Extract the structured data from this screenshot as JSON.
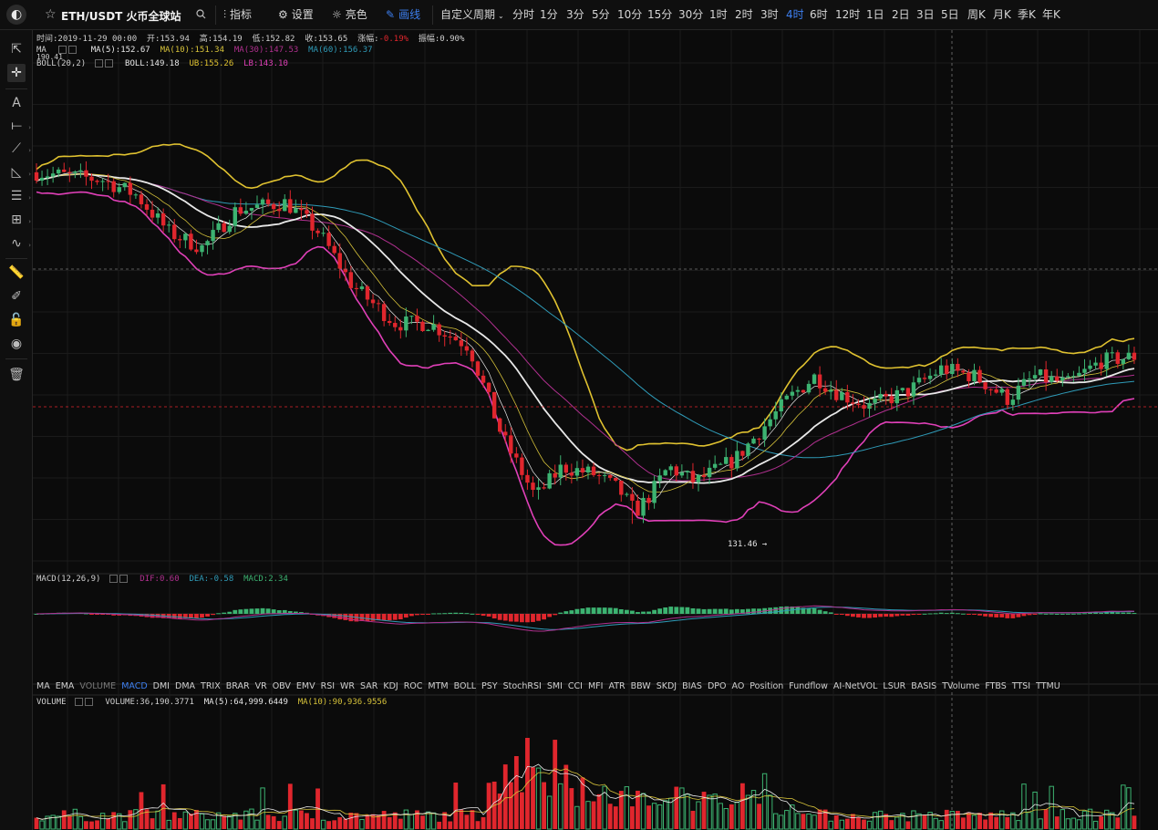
{
  "toolbar": {
    "symbol": "ETH/USDT 火币全球站",
    "indicators_label": "指标",
    "settings_label": "设置",
    "theme_label": "亮色",
    "draw_label": "画线",
    "custom_period_label": "自定义周期",
    "periods": [
      "分时",
      "1分",
      "3分",
      "5分",
      "10分",
      "15分",
      "30分",
      "1时",
      "2时",
      "3时",
      "4时",
      "6时",
      "12时",
      "1日",
      "2日",
      "3日",
      "5日",
      "周K",
      "月K",
      "季K",
      "年K"
    ],
    "selected_period": "4时"
  },
  "left_tools": [
    "cursor-arrow-icon",
    "crosshair-icon",
    "text-tool-icon",
    "horizontal-line-icon",
    "trend-line-icon",
    "triangle-icon",
    "parallel-lines-icon",
    "grid-icon",
    "wave-icon",
    "ruler-icon",
    "pencil-icon",
    "lock-icon",
    "eye-icon",
    "trash-icon"
  ],
  "info": {
    "time": "时间:2019-11-29 00:00",
    "open": "开:153.94",
    "high": "高:154.19",
    "low": "低:152.82",
    "close": "收:153.65",
    "change_label": "涨幅:",
    "change_value": "-0.19%",
    "amplitude": "振幅:0.90%"
  },
  "legend": {
    "ma_label": "MA",
    "ma5": "MA(5):152.67",
    "ma10": "MA(10):151.34",
    "ma30": "MA(30):147.53",
    "ma60": "MA(60):156.37",
    "boll_label": "BOLL(20,2)",
    "boll": "BOLL:149.18",
    "ub": "UB:155.26",
    "lb": "LB:143.10",
    "axis_top": "190.41",
    "low_marker": "131.46",
    "macd_label": "MACD(12,26,9)",
    "dif": "DIF:0.60",
    "dea": "DEA:-0.58",
    "macd": "MACD:2.34",
    "volume_label": "VOLUME",
    "volume": "VOLUME:36,190.3771",
    "vol_ma5": "MA(5):64,999.6449",
    "vol_ma10": "MA(10):90,936.9556"
  },
  "indicator_tabs": [
    "MA",
    "EMA",
    "VOLUME",
    "MACD",
    "DMI",
    "DMA",
    "TRIX",
    "BRAR",
    "VR",
    "OBV",
    "EMV",
    "RSI",
    "WR",
    "SAR",
    "KDJ",
    "ROC",
    "MTM",
    "BOLL",
    "PSY",
    "StochRSI",
    "SMI",
    "CCI",
    "MFI",
    "ATR",
    "BBW",
    "SKDJ",
    "BIAS",
    "DPO",
    "AO",
    "Position",
    "Fundflow",
    "AI-NetVOL",
    "LSUR",
    "BASIS",
    "TVolume",
    "FTBS",
    "TTSI",
    "TTMU"
  ],
  "indicator_tab_selected": "MACD",
  "indicator_tab_dim": "VOLUME",
  "colors": {
    "up": "#3cb371",
    "down": "#e0262d",
    "ma5": "#e8e8e8",
    "ma10": "#d6c23a",
    "ma30": "#b0308f",
    "ma60": "#2f9bb8",
    "boll_mid": "#e8e8e8",
    "boll_ub": "#e0c230",
    "boll_lb": "#e040b8",
    "accent": "#3d7ff0",
    "change_neg": "#e0262d"
  },
  "chart_data": {
    "type": "candlestick",
    "symbol": "ETH/USDT",
    "interval": "4h",
    "price_series_approx": [
      {
        "t": 0,
        "o": 175,
        "h": 178,
        "l": 170,
        "c": 172
      },
      {
        "t": 1,
        "o": 172,
        "h": 176,
        "l": 170,
        "c": 174
      },
      {
        "t": 2,
        "o": 174,
        "h": 176,
        "l": 171,
        "c": 172
      },
      {
        "t": 3,
        "o": 172,
        "h": 175,
        "l": 170,
        "c": 173
      },
      {
        "t": 4,
        "o": 173,
        "h": 176,
        "l": 171,
        "c": 174
      },
      {
        "t": 5,
        "o": 174,
        "h": 178,
        "l": 172,
        "c": 176
      },
      {
        "t": 6,
        "o": 176,
        "h": 179,
        "l": 174,
        "c": 177
      },
      {
        "t": 7,
        "o": 177,
        "h": 180,
        "l": 175,
        "c": 178
      },
      {
        "t": 8,
        "o": 178,
        "h": 181,
        "l": 175,
        "c": 176
      },
      {
        "t": 9,
        "o": 176,
        "h": 178,
        "l": 171,
        "c": 172
      },
      {
        "t": 10,
        "o": 172,
        "h": 175,
        "l": 170,
        "c": 171
      },
      {
        "t": 11,
        "o": 171,
        "h": 173,
        "l": 168,
        "c": 169
      },
      {
        "t": 12,
        "o": 169,
        "h": 172,
        "l": 166,
        "c": 167
      },
      {
        "t": 13,
        "o": 167,
        "h": 170,
        "l": 158,
        "c": 160
      },
      {
        "t": 14,
        "o": 160,
        "h": 165,
        "l": 157,
        "c": 163
      },
      {
        "t": 15,
        "o": 163,
        "h": 166,
        "l": 160,
        "c": 161
      },
      {
        "t": 16,
        "o": 161,
        "h": 165,
        "l": 159,
        "c": 164
      },
      {
        "t": 17,
        "o": 164,
        "h": 167,
        "l": 162,
        "c": 165
      },
      {
        "t": 18,
        "o": 165,
        "h": 168,
        "l": 163,
        "c": 166
      },
      {
        "t": 19,
        "o": 166,
        "h": 170,
        "l": 164,
        "c": 168
      },
      {
        "t": 20,
        "o": 168,
        "h": 172,
        "l": 166,
        "c": 170
      },
      {
        "t": 21,
        "o": 170,
        "h": 174,
        "l": 168,
        "c": 172
      },
      {
        "t": 22,
        "o": 172,
        "h": 175,
        "l": 169,
        "c": 170
      },
      {
        "t": 23,
        "o": 170,
        "h": 172,
        "l": 162,
        "c": 164
      },
      {
        "t": 24,
        "o": 164,
        "h": 166,
        "l": 155,
        "c": 157
      },
      {
        "t": 25,
        "o": 157,
        "h": 160,
        "l": 152,
        "c": 154
      },
      {
        "t": 26,
        "o": 154,
        "h": 157,
        "l": 151,
        "c": 153
      },
      {
        "t": 27,
        "o": 153,
        "h": 156,
        "l": 151,
        "c": 155
      },
      {
        "t": 28,
        "o": 155,
        "h": 157,
        "l": 153,
        "c": 154
      },
      {
        "t": 29,
        "o": 154,
        "h": 156,
        "l": 152,
        "c": 153
      },
      {
        "t": 30,
        "o": 153,
        "h": 155,
        "l": 141,
        "c": 143
      },
      {
        "t": 31,
        "o": 143,
        "h": 145,
        "l": 136,
        "c": 138
      },
      {
        "t": 32,
        "o": 138,
        "h": 140,
        "l": 134,
        "c": 136
      },
      {
        "t": 33,
        "o": 136,
        "h": 139,
        "l": 131.46,
        "c": 133
      },
      {
        "t": 34,
        "o": 133,
        "h": 138,
        "l": 132,
        "c": 136
      },
      {
        "t": 35,
        "o": 136,
        "h": 138,
        "l": 133,
        "c": 134
      },
      {
        "t": 36,
        "o": 134,
        "h": 139,
        "l": 133,
        "c": 138
      },
      {
        "t": 37,
        "o": 138,
        "h": 140,
        "l": 136,
        "c": 139
      },
      {
        "t": 38,
        "o": 139,
        "h": 141,
        "l": 137,
        "c": 140
      },
      {
        "t": 39,
        "o": 140,
        "h": 146,
        "l": 139,
        "c": 145
      },
      {
        "t": 40,
        "o": 145,
        "h": 147,
        "l": 143,
        "c": 146
      },
      {
        "t": 41,
        "o": 146,
        "h": 149,
        "l": 145,
        "c": 148
      },
      {
        "t": 42,
        "o": 148,
        "h": 150,
        "l": 146,
        "c": 147
      },
      {
        "t": 43,
        "o": 147,
        "h": 149,
        "l": 145,
        "c": 146
      },
      {
        "t": 44,
        "o": 146,
        "h": 149,
        "l": 145,
        "c": 148
      },
      {
        "t": 45,
        "o": 148,
        "h": 153,
        "l": 147,
        "c": 152
      },
      {
        "t": 46,
        "o": 152,
        "h": 155,
        "l": 150,
        "c": 151
      },
      {
        "t": 47,
        "o": 151,
        "h": 154,
        "l": 150,
        "c": 153
      },
      {
        "t": 48,
        "o": 153,
        "h": 156,
        "l": 151,
        "c": 152
      },
      {
        "t": 49,
        "o": 152,
        "h": 154,
        "l": 151,
        "c": 153
      },
      {
        "t": 50,
        "o": 153.94,
        "h": 154.19,
        "l": 152.82,
        "c": 153.65
      }
    ]
  }
}
